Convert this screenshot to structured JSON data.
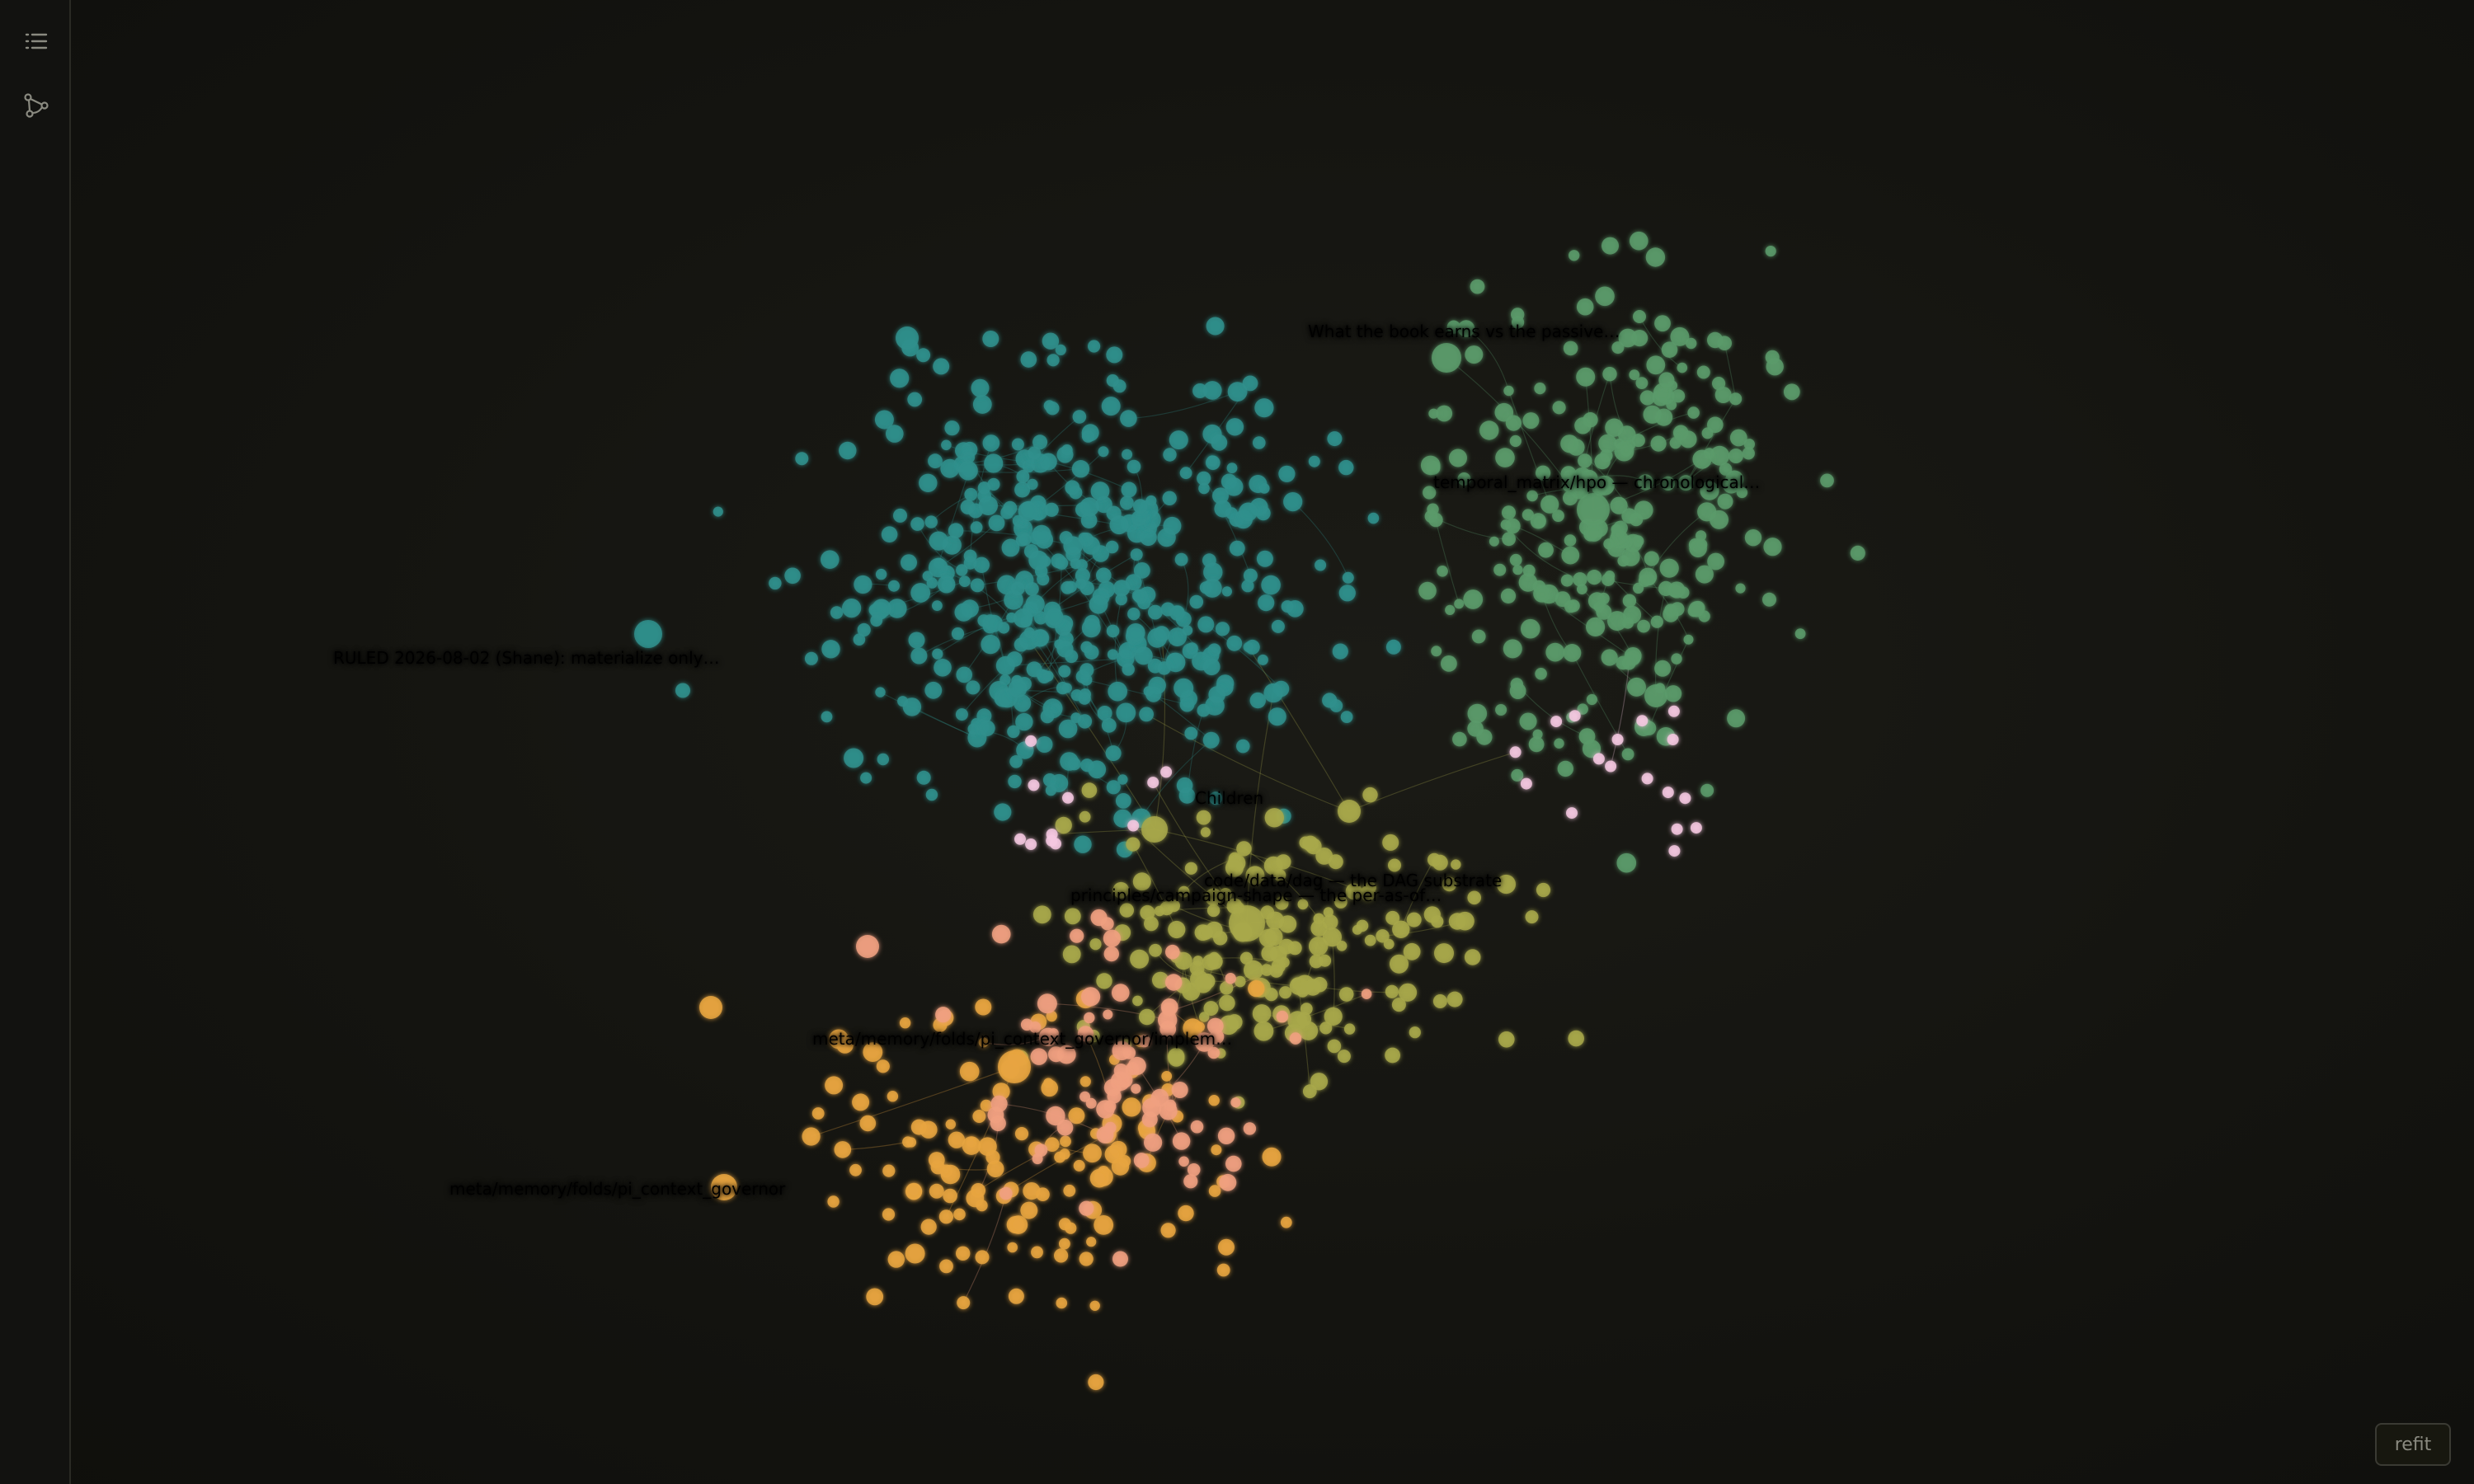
{
  "sidebar": {
    "items": [
      {
        "icon": "list-icon"
      },
      {
        "icon": "graph-icon"
      }
    ]
  },
  "graph": {
    "palette": {
      "teal": "#2f8f8c",
      "green": "#5a9a6a",
      "olive": "#a8a84a",
      "orange": "#e8a540",
      "salmon": "#f0a080",
      "pink": "#f5c8e0",
      "edge": "#3f7c78"
    },
    "labels": [
      {
        "text": "What the book earns vs the passive…",
        "color": "#9fc8a0"
      },
      {
        "text": "temporal_matrix/hpo — chronological…",
        "color": "#9fc8a0"
      },
      {
        "text": "RULED 2026-08-02 (Shane): materialize only…",
        "color": "#6fb0ad"
      },
      {
        "text": "Children",
        "color": "#d8d090"
      },
      {
        "text": "code/data/dag — the DAG substrate",
        "color": "#c8d090"
      },
      {
        "text": "principles/campaign-shape — the per-as-of…",
        "color": "#e0d090"
      },
      {
        "text": "meta/memory/folds/pi_context_governor/implem…",
        "color": "#f0c070"
      },
      {
        "text": "meta/memory/folds/pi_context_governor",
        "color": "#f0c070"
      }
    ]
  },
  "controls": {
    "refit_label": "refit"
  }
}
